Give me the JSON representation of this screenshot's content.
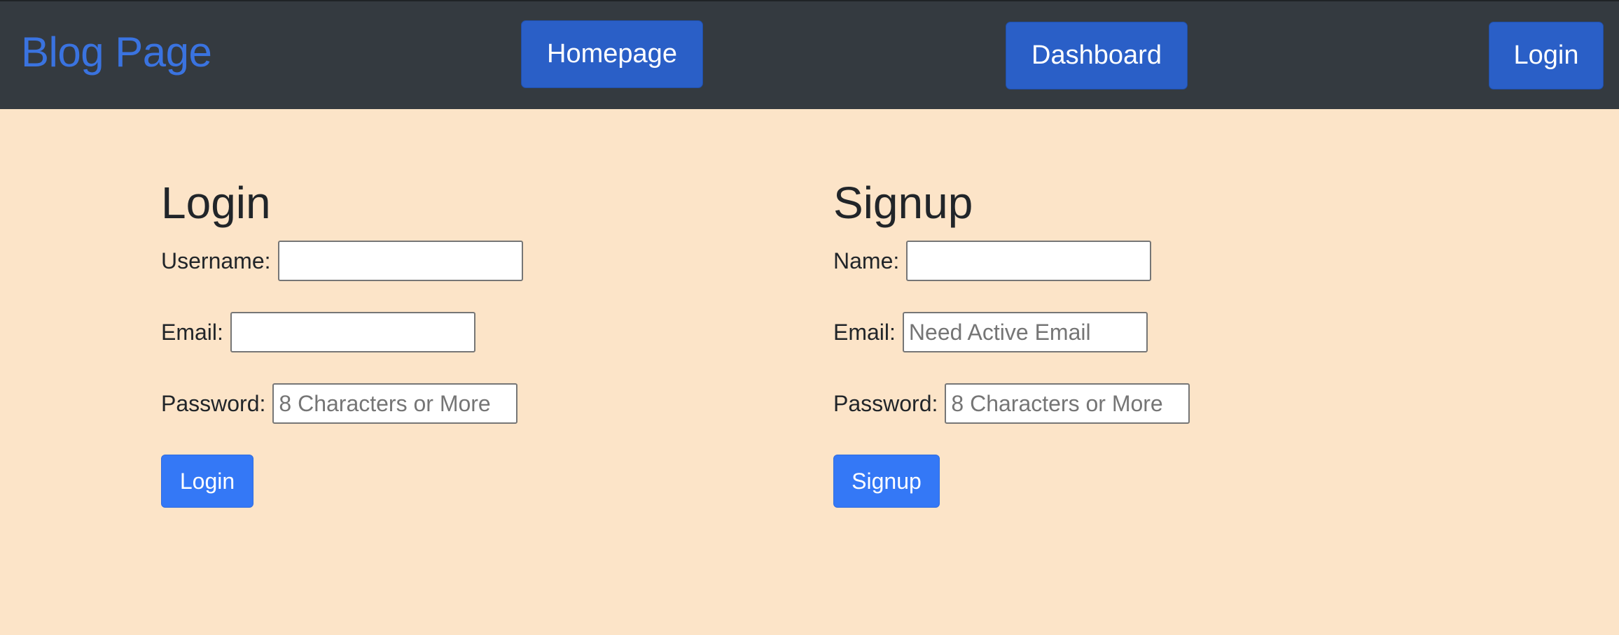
{
  "navbar": {
    "brand": "Blog Page",
    "links": {
      "homepage": "Homepage",
      "dashboard": "Dashboard",
      "login": "Login"
    }
  },
  "login_form": {
    "title": "Login",
    "username_label": "Username:",
    "username_value": "",
    "email_label": "Email:",
    "email_value": "",
    "password_label": "Password:",
    "password_placeholder": "8 Characters or More",
    "submit_label": "Login"
  },
  "signup_form": {
    "title": "Signup",
    "name_label": "Name:",
    "name_value": "",
    "email_label": "Email:",
    "email_placeholder": "Need Active Email",
    "password_label": "Password:",
    "password_placeholder": "8 Characters or More",
    "submit_label": "Signup"
  },
  "colors": {
    "page_background": "#fce4c8",
    "navbar_background": "#343a40",
    "brand_text": "#3a73e0",
    "nav_button": "#2a5fc7",
    "submit_button": "#3478f6"
  }
}
